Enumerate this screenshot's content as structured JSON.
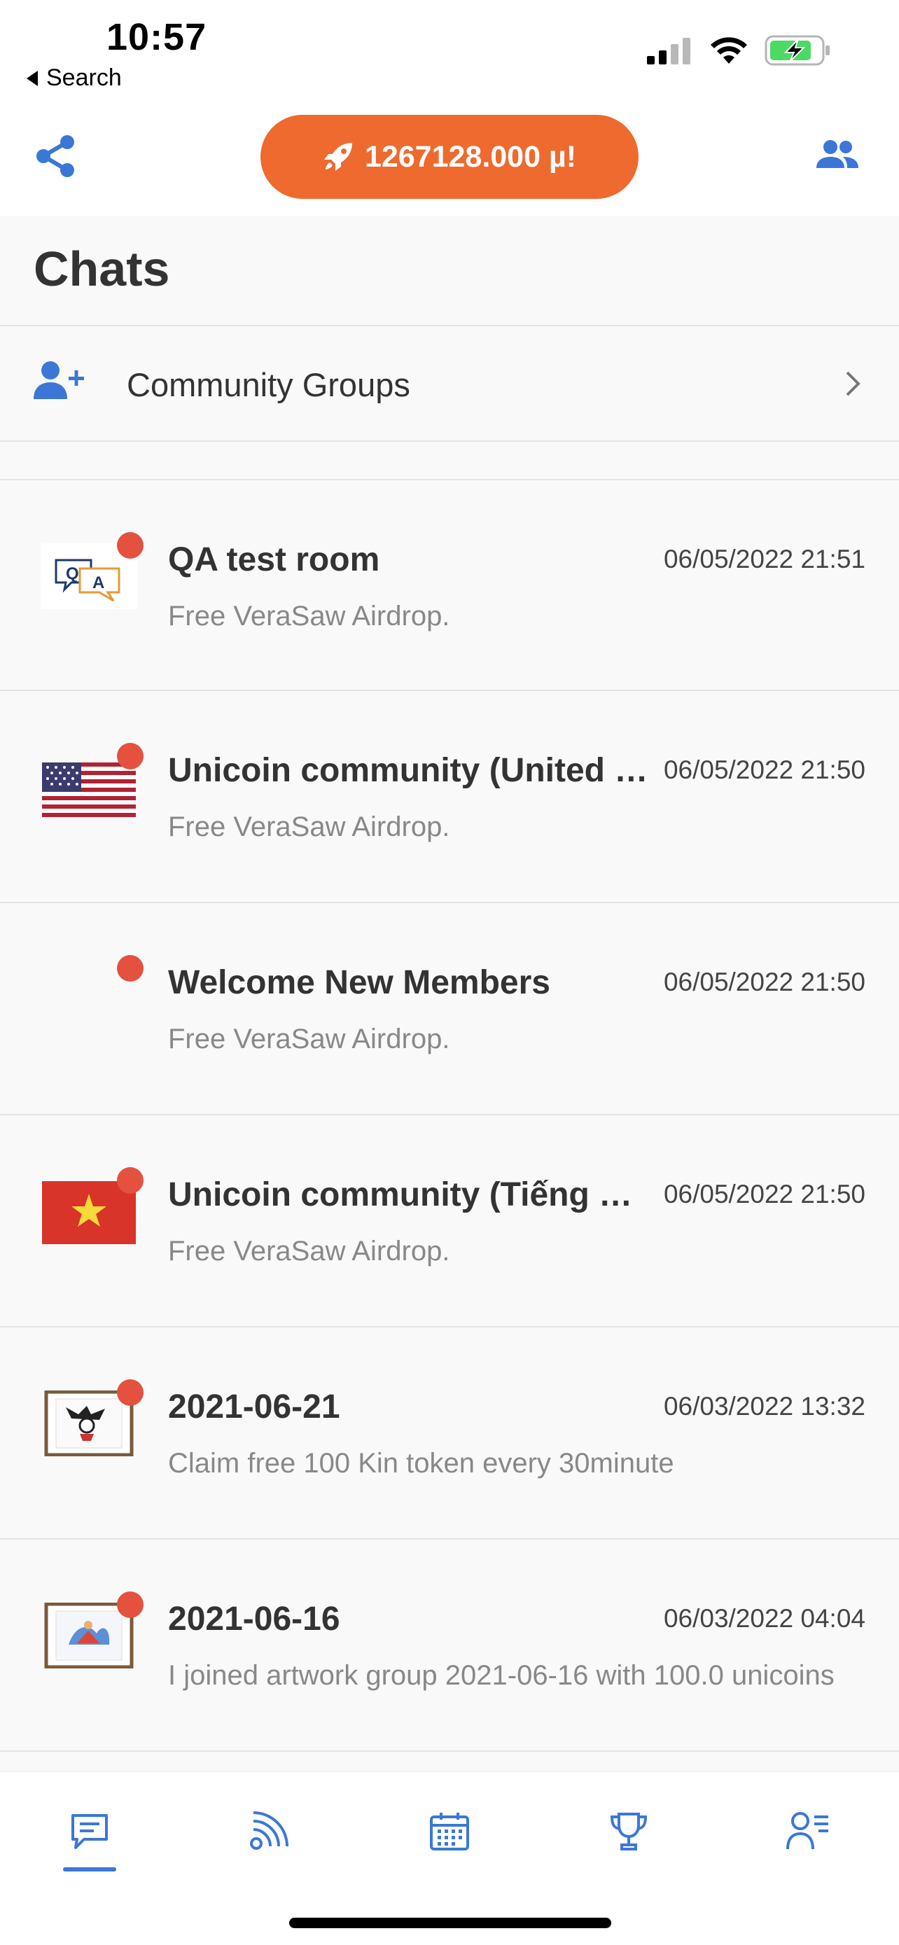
{
  "status_bar": {
    "time": "10:57",
    "back_label": "Search",
    "icons": [
      "signal-icon",
      "wifi-icon",
      "battery-charging-icon"
    ]
  },
  "header": {
    "balance": "1267128.000 µ!",
    "icons": [
      "share-icon",
      "rocket-icon",
      "people-icon"
    ]
  },
  "page": {
    "title": "Chats",
    "community_groups_label": "Community Groups"
  },
  "chats": [
    {
      "name": "QA test room",
      "time": "06/05/2022 21:51",
      "message": "Free VeraSaw Airdrop.",
      "avatar": "qa-chat-icon",
      "unread": true
    },
    {
      "name": "Unicoin community (United States)",
      "time": "06/05/2022 21:50",
      "message": "Free VeraSaw Airdrop.",
      "avatar": "us-flag-icon",
      "unread": true
    },
    {
      "name": "Welcome New Members",
      "time": "06/05/2022 21:50",
      "message": "Free VeraSaw Airdrop.",
      "avatar": "",
      "unread": true
    },
    {
      "name": "Unicoin community (Tiếng Việt)",
      "time": "06/05/2022 21:50",
      "message": "Free VeraSaw Airdrop.",
      "avatar": "vietnam-flag-icon",
      "unread": true
    },
    {
      "name": "2021-06-21",
      "time": "06/03/2022 13:32",
      "message": "Claim free 100 Kin token every 30minute",
      "avatar": "framed-artwork-icon",
      "unread": true
    },
    {
      "name": "2021-06-16",
      "time": "06/03/2022 04:04",
      "message": "I joined artwork group 2021-06-16 with 100.0 unicoins",
      "avatar": "framed-artwork-icon",
      "unread": true
    }
  ],
  "tabbar": {
    "active": "chats",
    "tabs": [
      "chat-icon",
      "feed-icon",
      "calendar-icon",
      "trophy-icon",
      "profile-list-icon"
    ]
  },
  "colors": {
    "accent": "#3C77D6",
    "balance_button": "#EE6A2E",
    "unread_dot": "#E4513F"
  }
}
